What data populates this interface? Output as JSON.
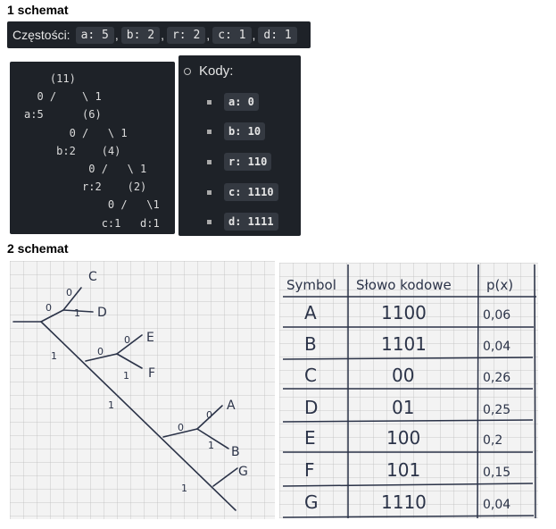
{
  "section1": {
    "title": "1 schemat"
  },
  "section2": {
    "title": "2 schemat"
  },
  "frequencies": {
    "label": "Częstości:",
    "items": [
      "a: 5",
      "b: 2",
      "r: 2",
      "c: 1",
      "d: 1"
    ]
  },
  "code_tree": {
    "lines": [
      "    (11)",
      "  0 /    \\ 1",
      "a:5      (6)",
      "       0 /   \\ 1",
      "     b:2    (4)",
      "          0 /   \\ 1",
      "         r:2    (2)",
      "             0 /   \\1",
      "            c:1   d:1"
    ]
  },
  "codes": {
    "title": "Kody:",
    "items": [
      "a: 0",
      "b: 10",
      "r: 110",
      "c: 1110",
      "d: 1111"
    ]
  },
  "tree_photo": {
    "labels": [
      "C",
      "D",
      "E",
      "F",
      "A",
      "B",
      "G",
      "0",
      "1",
      "0",
      "1",
      "0",
      "1",
      "0",
      "1",
      "0",
      "1",
      "0",
      "1"
    ]
  },
  "table_photo": {
    "headers": [
      "Symbol",
      "Słowo kodowe",
      "p(x)"
    ],
    "rows": [
      [
        "A",
        "1100",
        "0,06"
      ],
      [
        "B",
        "1101",
        "0,04"
      ],
      [
        "C",
        "00",
        "0,26"
      ],
      [
        "D",
        "01",
        "0,25"
      ],
      [
        "E",
        "100",
        "0,2"
      ],
      [
        "F",
        "101",
        "0,15"
      ],
      [
        "G",
        "1110",
        "0,04"
      ]
    ]
  },
  "colors": {
    "panel": "#1e2228",
    "chip": "#343941",
    "ink": "#2b3348"
  }
}
